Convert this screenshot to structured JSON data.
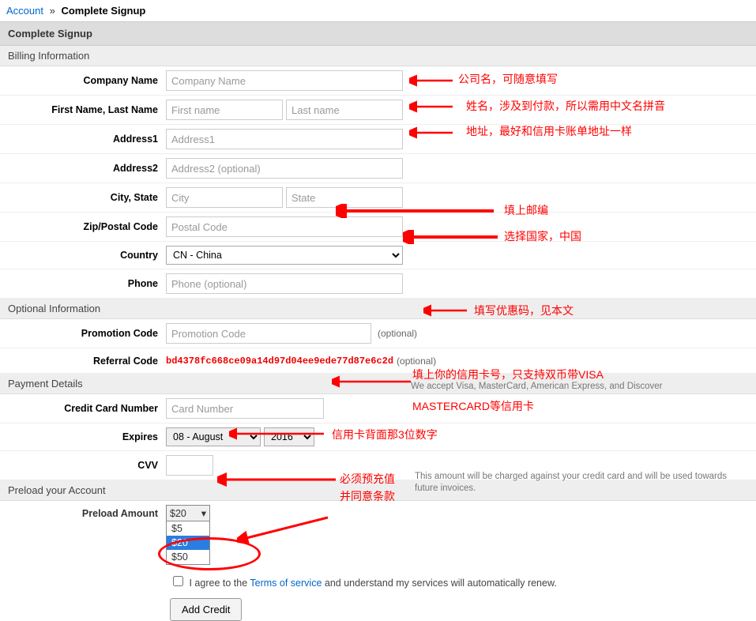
{
  "breadcrumb": {
    "account": "Account",
    "sep": "»",
    "current": "Complete Signup"
  },
  "panel_title": "Complete Signup",
  "sections": {
    "billing": "Billing Information",
    "optional": "Optional Information",
    "payment": "Payment Details",
    "preload": "Preload your Account"
  },
  "labels": {
    "company": "Company Name",
    "name": "First Name, Last Name",
    "address1": "Address1",
    "address2": "Address2",
    "citystate": "City, State",
    "zip": "Zip/Postal Code",
    "country": "Country",
    "phone": "Phone",
    "promo": "Promotion Code",
    "referral": "Referral Code",
    "cc": "Credit Card Number",
    "expires": "Expires",
    "cvv": "CVV",
    "preload": "Preload Amount"
  },
  "placeholders": {
    "company": "Company Name",
    "first": "First name",
    "last": "Last name",
    "address1": "Address1",
    "address2": "Address2 (optional)",
    "city": "City",
    "state": "State",
    "zip": "Postal Code",
    "phone": "Phone (optional)",
    "promo": "Promotion Code",
    "cc": "Card Number"
  },
  "values": {
    "country": "CN - China",
    "referral": "bd4378fc668ce09a14d97d04ee9ede77d87e6c2d",
    "exp_month": "08 - August",
    "exp_year": "2016"
  },
  "optional_text": "(optional)",
  "cc_hint": "We accept Visa, MasterCard, American Express, and Discover",
  "preload_hint": "This amount will be charged against your credit card and will be used towards future invoices.",
  "preload_options": {
    "selected_display": "$20",
    "opt1": "$5",
    "opt2": "$20",
    "opt3": "$50"
  },
  "agree": {
    "prefix": "I agree to the ",
    "link": "Terms of service",
    "suffix": " and understand my services will automatically renew."
  },
  "button": "Add Credit",
  "annotations": {
    "company": "公司名，可随意填写",
    "name": "姓名，涉及到付款，所以需用中文名拼音",
    "address": "地址，最好和信用卡账单地址一样",
    "zip": "填上邮编",
    "country": "选择国家，中国",
    "promo": "填写优惠码，见本文",
    "cc1": "填上你的信用卡号，只支持双币带VISA",
    "cc2": "MASTERCARD等信用卡",
    "cvv": "信用卡背面那3位数字",
    "preload1": "必须预充值",
    "preload2": "并同意条款"
  }
}
